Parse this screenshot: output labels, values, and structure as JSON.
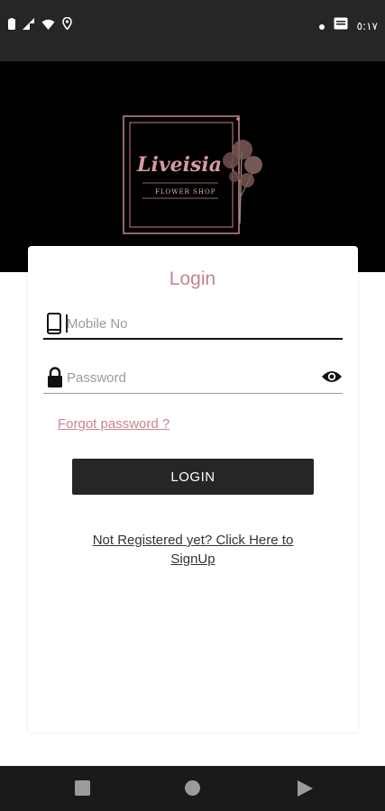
{
  "status_bar": {
    "time": "٥:١٧",
    "icons": [
      "battery-icon",
      "signal-icon",
      "wifi-icon",
      "location-icon",
      "notification-dot-icon",
      "message-icon"
    ]
  },
  "brand": {
    "logo_name": "Liveisia",
    "logo_subtitle": "FLOWER SHOP",
    "header_color": "#000000",
    "accent_color": "#c8848f"
  },
  "login": {
    "title": "Login",
    "mobile_placeholder": "Mobile No",
    "password_placeholder": "Password",
    "forgot_password": "Forgot password ?",
    "login_button": "LOGIN",
    "signup_line1": "Not Registered yet? Click Here to",
    "signup_line2": "SignUp"
  },
  "nav_bar": {
    "buttons": [
      "recents-square-icon",
      "home-circle-icon",
      "back-triangle-icon"
    ]
  }
}
